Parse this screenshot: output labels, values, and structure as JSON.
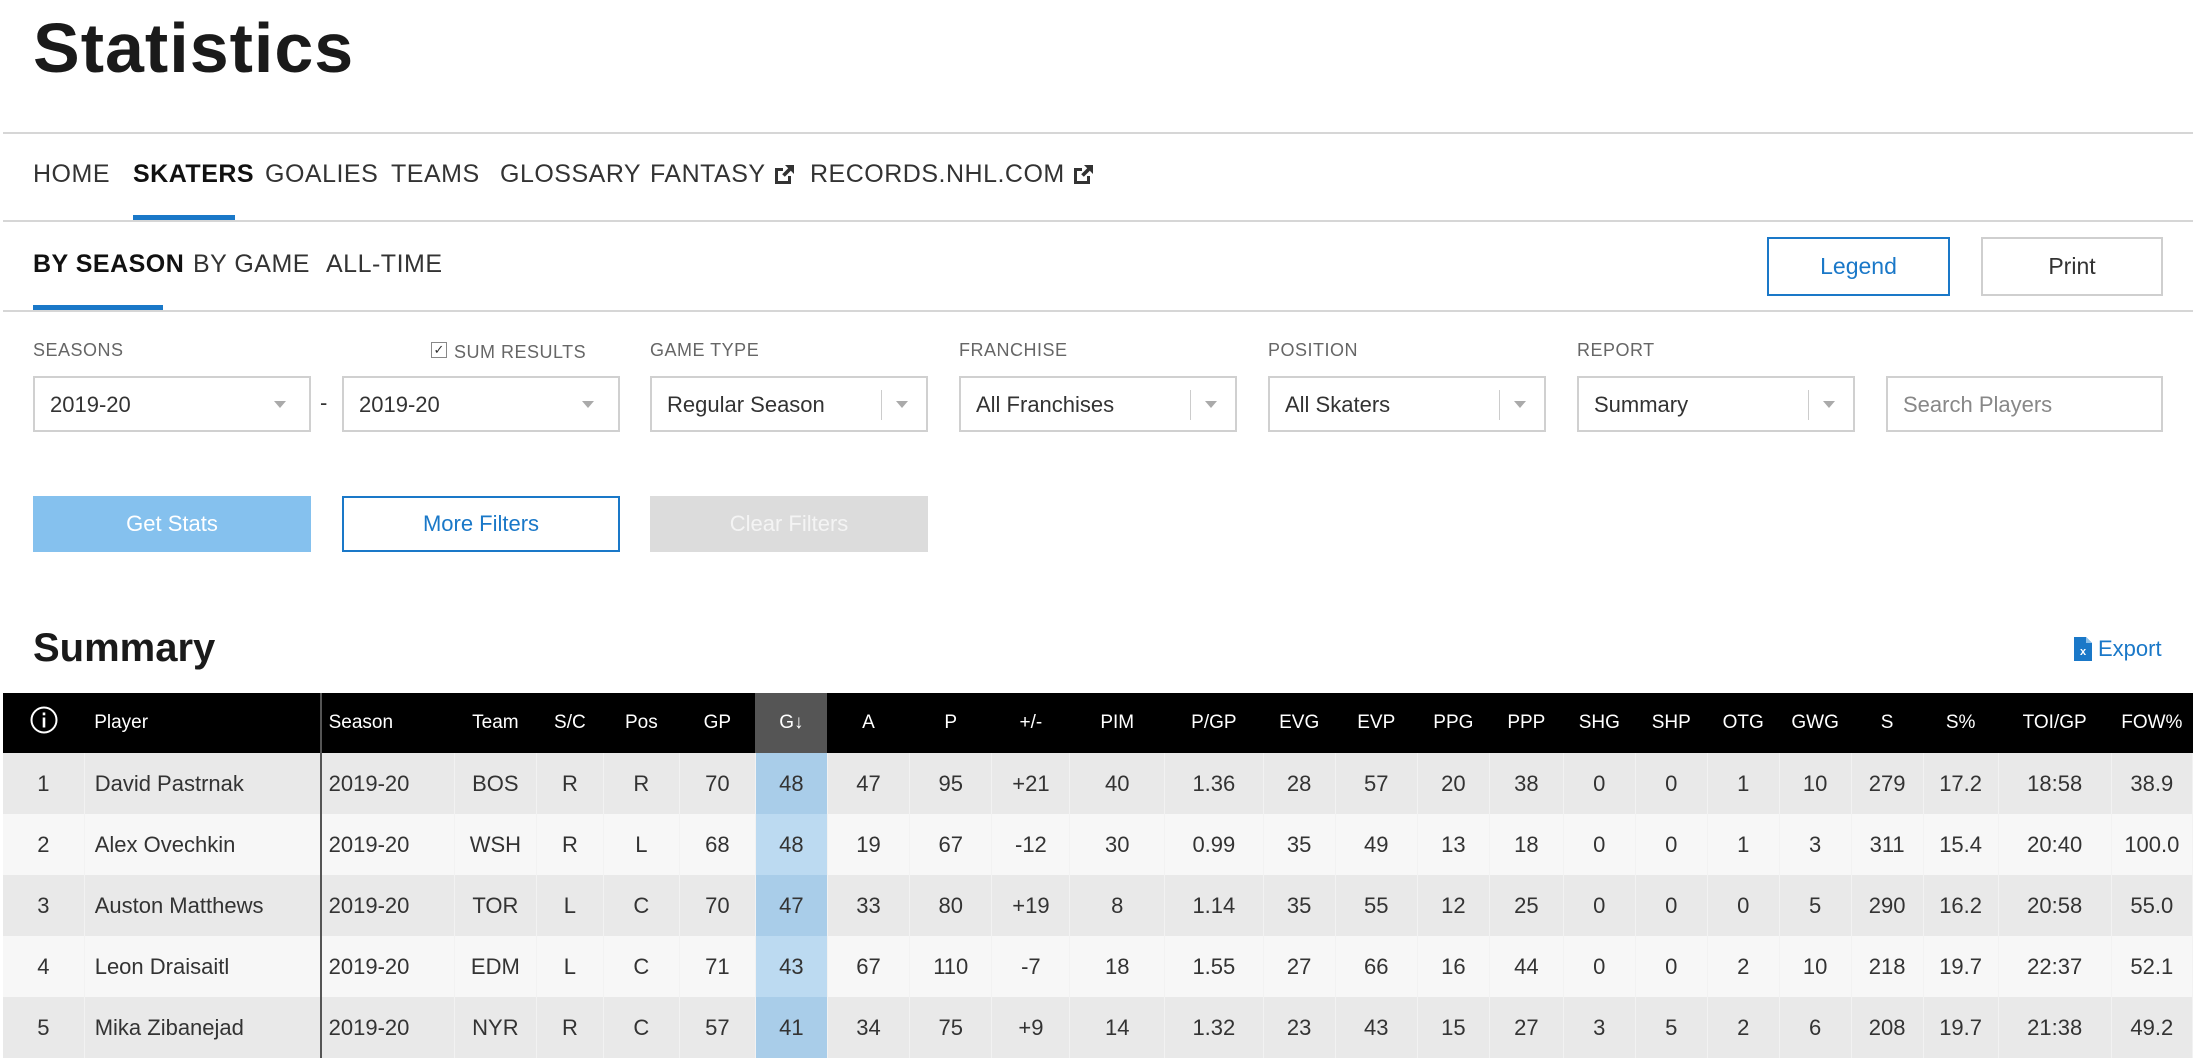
{
  "page_title": "Statistics",
  "nav": [
    {
      "label": "HOME",
      "active": false
    },
    {
      "label": "SKATERS",
      "active": true
    },
    {
      "label": "GOALIES",
      "active": false
    },
    {
      "label": "TEAMS",
      "active": false
    },
    {
      "label": "GLOSSARY",
      "active": false
    },
    {
      "label": "FANTASY",
      "active": false,
      "external": true
    },
    {
      "label": "RECORDS.NHL.COM",
      "active": false,
      "external": true
    }
  ],
  "subnav": [
    {
      "label": "BY SEASON",
      "active": true
    },
    {
      "label": "BY GAME",
      "active": false
    },
    {
      "label": "ALL-TIME",
      "active": false
    }
  ],
  "actions": {
    "legend": "Legend",
    "print": "Print"
  },
  "filters": {
    "seasons_label": "SEASONS",
    "sum_results_label": "SUM RESULTS",
    "sum_results_checked": true,
    "season_from": "2019-20",
    "season_dash": "-",
    "season_to": "2019-20",
    "game_type_label": "GAME TYPE",
    "game_type": "Regular Season",
    "franchise_label": "FRANCHISE",
    "franchise": "All Franchises",
    "position_label": "POSITION",
    "position": "All Skaters",
    "report_label": "REPORT",
    "report": "Summary",
    "search_placeholder": "Search Players"
  },
  "buttons": {
    "get_stats": "Get Stats",
    "more_filters": "More Filters",
    "clear_filters": "Clear Filters"
  },
  "summary": {
    "title": "Summary",
    "export": "Export"
  },
  "colors": {
    "accent": "#1a78c8",
    "positive": "#3c9a3c",
    "negative": "#c0303a",
    "sorted_column": "#a9cde9"
  },
  "table": {
    "info_icon": "info-circle-icon",
    "columns": [
      "Player",
      "Season",
      "Team",
      "S/C",
      "Pos",
      "GP",
      "G↓",
      "A",
      "P",
      "+/-",
      "PIM",
      "P/GP",
      "EVG",
      "EVP",
      "PPG",
      "PPP",
      "SHG",
      "SHP",
      "OTG",
      "GWG",
      "S",
      "S%",
      "TOI/GP",
      "FOW%"
    ],
    "rows": [
      [
        "1",
        "David Pastrnak",
        "2019-20",
        "BOS",
        "R",
        "R",
        "70",
        "48",
        "47",
        "95",
        "+21",
        "40",
        "1.36",
        "28",
        "57",
        "20",
        "38",
        "0",
        "0",
        "1",
        "10",
        "279",
        "17.2",
        "18:58",
        "38.9"
      ],
      [
        "2",
        "Alex Ovechkin",
        "2019-20",
        "WSH",
        "R",
        "L",
        "68",
        "48",
        "19",
        "67",
        "-12",
        "30",
        "0.99",
        "35",
        "49",
        "13",
        "18",
        "0",
        "0",
        "1",
        "3",
        "311",
        "15.4",
        "20:40",
        "100.0"
      ],
      [
        "3",
        "Auston Matthews",
        "2019-20",
        "TOR",
        "L",
        "C",
        "70",
        "47",
        "33",
        "80",
        "+19",
        "8",
        "1.14",
        "35",
        "55",
        "12",
        "25",
        "0",
        "0",
        "0",
        "5",
        "290",
        "16.2",
        "20:58",
        "55.0"
      ],
      [
        "4",
        "Leon Draisaitl",
        "2019-20",
        "EDM",
        "L",
        "C",
        "71",
        "43",
        "67",
        "110",
        "-7",
        "18",
        "1.55",
        "27",
        "66",
        "16",
        "44",
        "0",
        "0",
        "2",
        "10",
        "218",
        "19.7",
        "22:37",
        "52.1"
      ],
      [
        "5",
        "Mika Zibanejad",
        "2019-20",
        "NYR",
        "R",
        "C",
        "57",
        "41",
        "34",
        "75",
        "+9",
        "14",
        "1.32",
        "23",
        "43",
        "15",
        "27",
        "3",
        "5",
        "2",
        "6",
        "208",
        "19.7",
        "21:38",
        "49.2"
      ]
    ]
  }
}
